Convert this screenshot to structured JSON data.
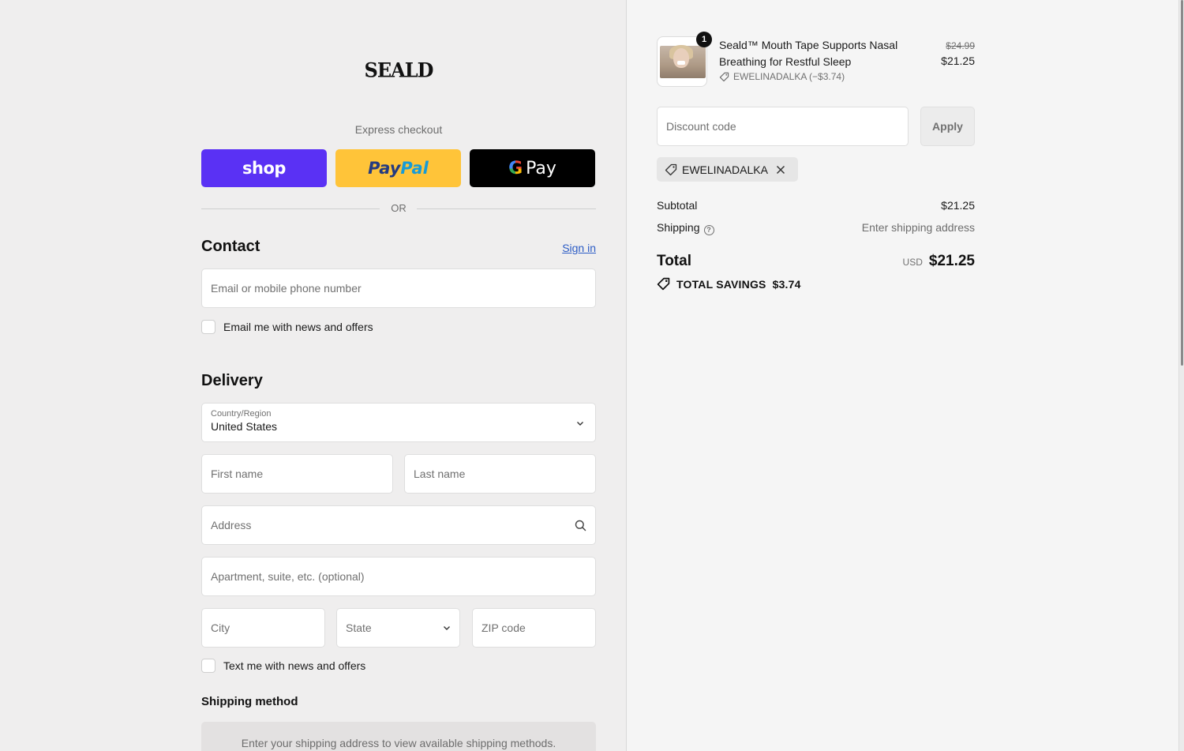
{
  "brand": {
    "logo_text": "SEALD"
  },
  "express": {
    "label": "Express checkout",
    "shop_label": "shop",
    "paypal_part1": "Pay",
    "paypal_part2": "Pal",
    "gpay_g": "G",
    "gpay_label": "Pay",
    "or_label": "OR"
  },
  "contact": {
    "heading": "Contact",
    "signin_label": "Sign in",
    "email_placeholder": "Email or mobile phone number",
    "news_checkbox_label": "Email me with news and offers"
  },
  "delivery": {
    "heading": "Delivery",
    "country_label": "Country/Region",
    "country_value": "United States",
    "first_name_placeholder": "First name",
    "last_name_placeholder": "Last name",
    "address_placeholder": "Address",
    "apartment_placeholder": "Apartment, suite, etc. (optional)",
    "city_placeholder": "City",
    "state_placeholder": "State",
    "zip_placeholder": "ZIP code",
    "text_checkbox_label": "Text me with news and offers"
  },
  "shipping_method": {
    "heading": "Shipping method",
    "info": "Enter your shipping address to view available shipping methods."
  },
  "summary": {
    "product": {
      "quantity": "1",
      "name": "Seald™ Mouth Tape Supports Nasal Breathing for Restful Sleep",
      "discount_line": "EWELINADALKA (−$3.74)",
      "original_price": "$24.99",
      "price": "$21.25"
    },
    "discount_placeholder": "Discount code",
    "apply_label": "Apply",
    "applied_code": "EWELINADALKA",
    "subtotal_label": "Subtotal",
    "subtotal_value": "$21.25",
    "shipping_label": "Shipping",
    "shipping_help_glyph": "?",
    "shipping_value": "Enter shipping address",
    "total_label": "Total",
    "total_currency": "USD",
    "total_value": "$21.25",
    "savings_label": "TOTAL SAVINGS",
    "savings_value": "$3.74"
  },
  "colors": {
    "shop_pay": "#5a31f4",
    "paypal": "#ffc439",
    "gpay": "#000000",
    "link": "#2c5cc5"
  }
}
